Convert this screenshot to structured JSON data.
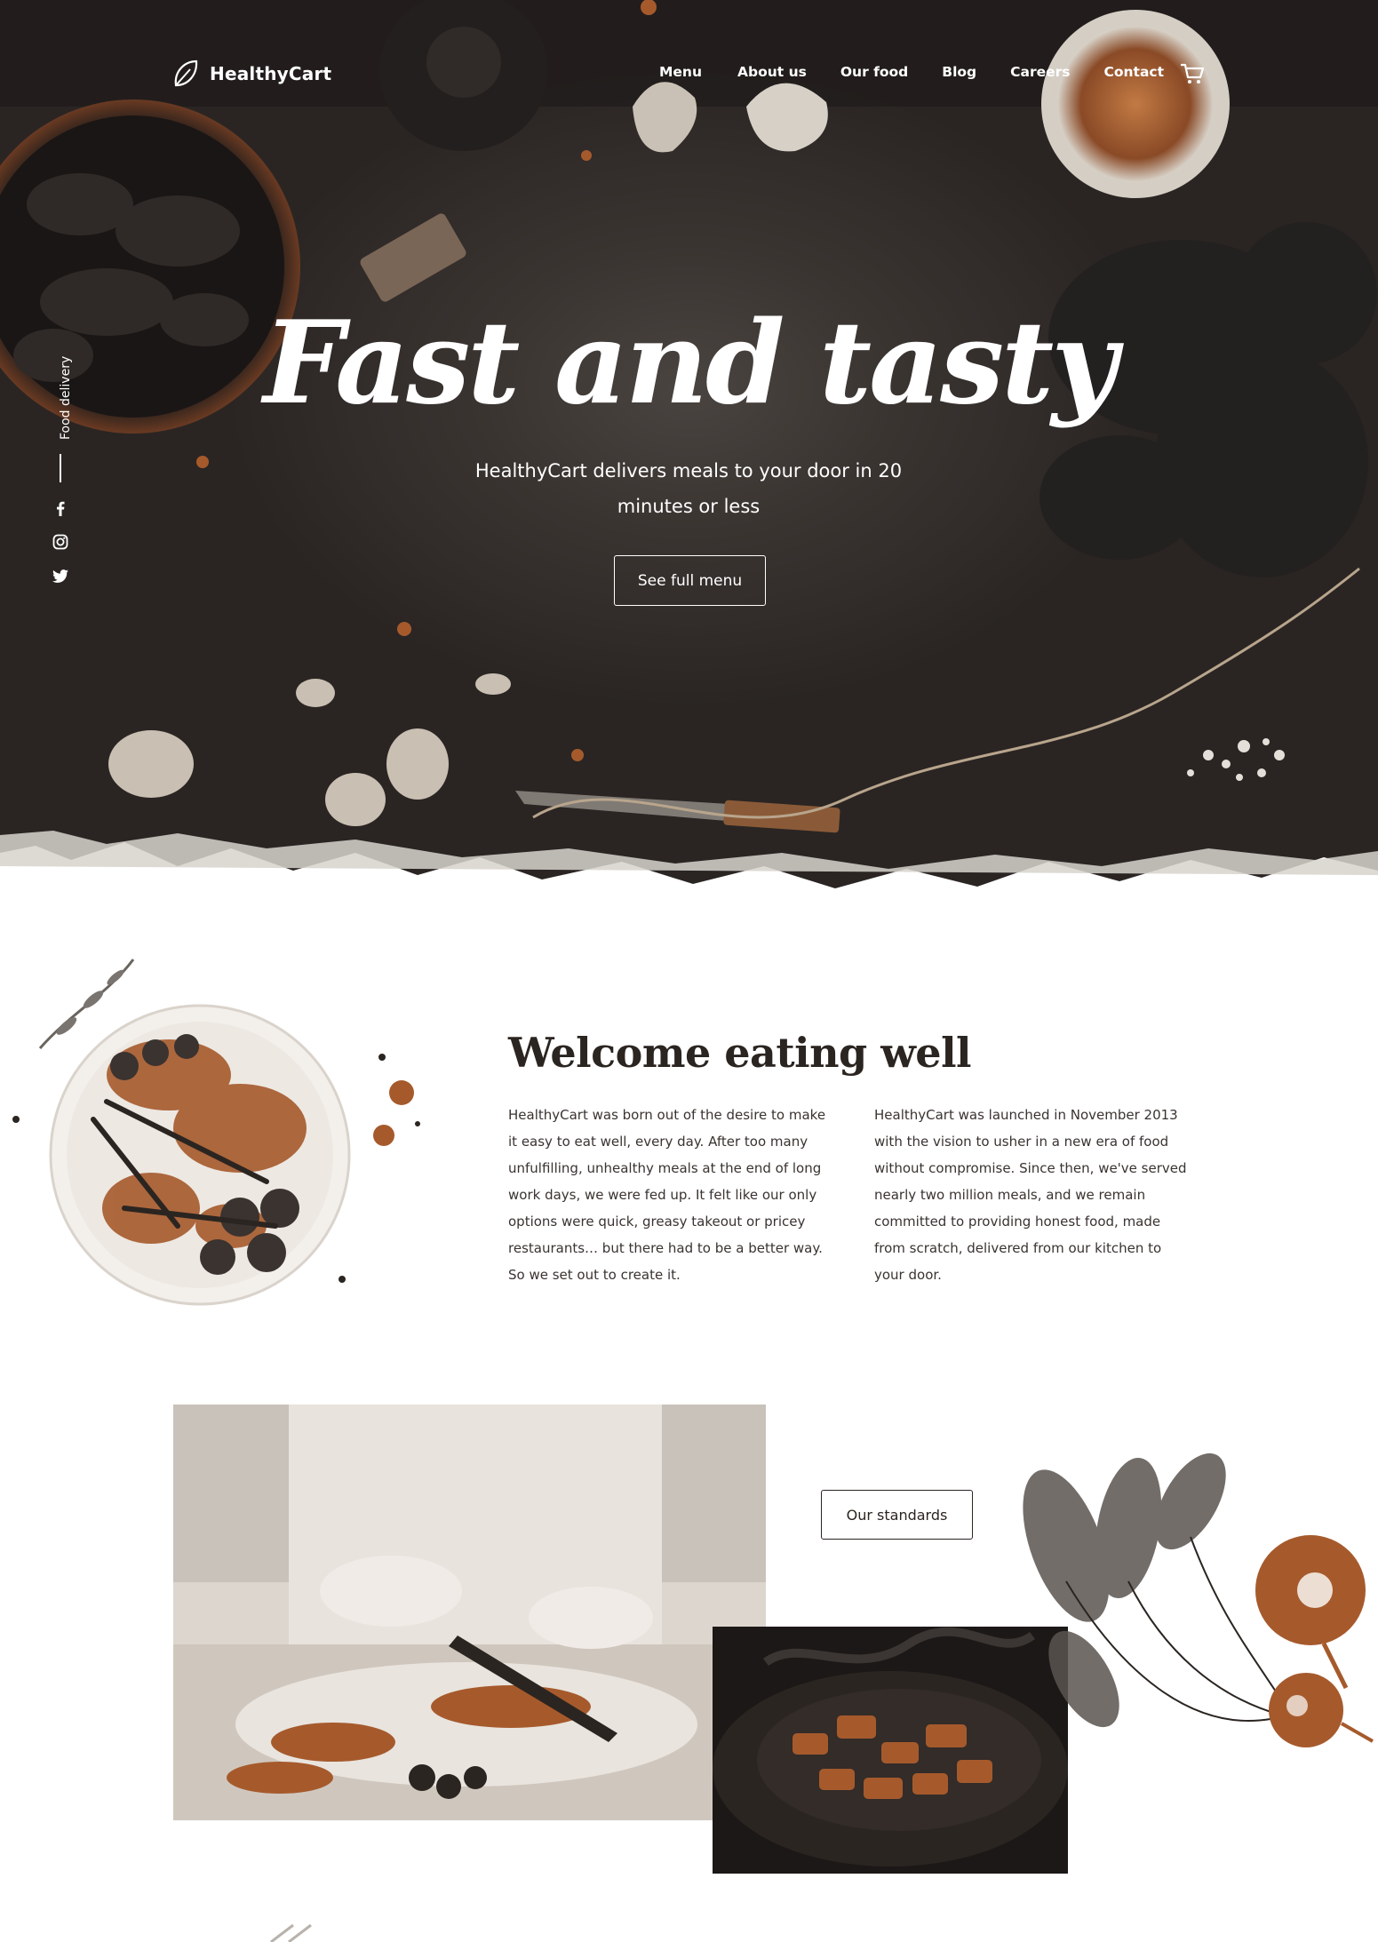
{
  "brand": {
    "name": "HealthyCart",
    "logo_icon": "leaf-icon"
  },
  "nav": {
    "items": [
      {
        "label": "Menu"
      },
      {
        "label": "About us"
      },
      {
        "label": "Our food"
      },
      {
        "label": "Blog"
      },
      {
        "label": "Careers"
      },
      {
        "label": "Contact"
      }
    ],
    "cart_icon": "cart-icon"
  },
  "side_rail": {
    "label": "Food delivery",
    "social": [
      "facebook-icon",
      "instagram-icon",
      "twitter-icon"
    ]
  },
  "hero": {
    "title": "Fast and tasty",
    "subtitle": "HealthyCart delivers meals to your door in 20 minutes or less",
    "cta_label": "See full menu"
  },
  "welcome": {
    "title": "Welcome eating well",
    "paragraph_1": "HealthyCart was born out of the desire to make it easy to eat well, every day. After too many unfulfilling, unhealthy meals at the end of long work days, we were fed up. It felt like our only options were quick, greasy takeout or pricey restaurants… but there had to be a better way. So we set out to create it.",
    "paragraph_2": "HealthyCart was launched in November 2013 with the vision to usher in a new era of food without compromise. Since then, we've served nearly two million meals, and we remain committed to providing honest food, made from scratch, delivered from our kitchen to your door."
  },
  "standards": {
    "cta_label": "Our standards"
  },
  "colors": {
    "accent": "#a65a2c",
    "dark": "#2b2521",
    "hero_bg": "#3a3431"
  }
}
